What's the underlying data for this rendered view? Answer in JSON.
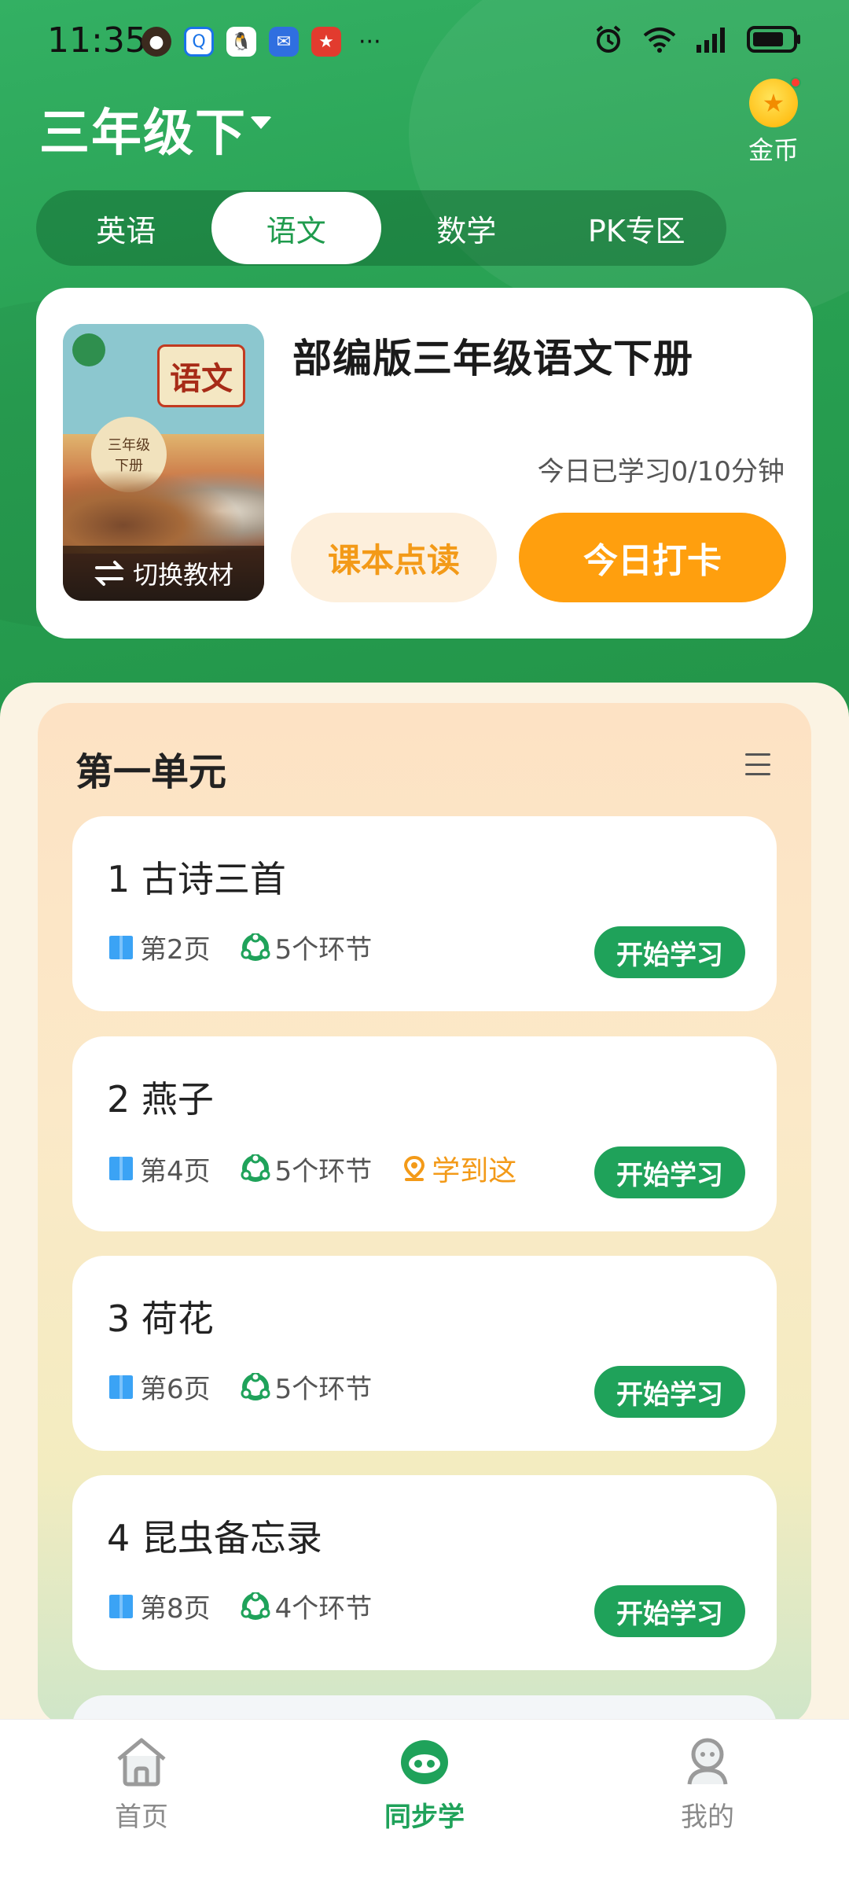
{
  "status_bar": {
    "time": "11:35",
    "more": "···"
  },
  "header": {
    "grade": "三年级下",
    "coins_label": "金币"
  },
  "tabs": [
    {
      "label": "英语",
      "active": false
    },
    {
      "label": "语文",
      "active": true
    },
    {
      "label": "数学",
      "active": false
    },
    {
      "label": "PK专区",
      "active": false
    }
  ],
  "book": {
    "title": "部编版三年级语文下册",
    "cover_subject": "语文",
    "cover_grade": "三年级",
    "cover_volume": "下册",
    "switch_label": "切换教材",
    "study_time": "今日已学习0/10分钟",
    "read_button": "课本点读",
    "checkin_button": "今日打卡"
  },
  "unit": {
    "title": "第一单元",
    "lessons": [
      {
        "title": "1 古诗三首",
        "page": "第2页",
        "steps": "5个环节",
        "marker": "",
        "button": "开始学习"
      },
      {
        "title": "2 燕子",
        "page": "第4页",
        "steps": "5个环节",
        "marker": "学到这",
        "button": "开始学习"
      },
      {
        "title": "3 荷花",
        "page": "第6页",
        "steps": "5个环节",
        "marker": "",
        "button": "开始学习"
      },
      {
        "title": "4 昆虫备忘录",
        "page": "第8页",
        "steps": "4个环节",
        "marker": "",
        "button": "开始学习"
      }
    ]
  },
  "bottom_nav": [
    {
      "label": "首页",
      "icon": "home-icon",
      "active": false
    },
    {
      "label": "同步学",
      "icon": "sync-learn-icon",
      "active": true
    },
    {
      "label": "我的",
      "icon": "profile-icon",
      "active": false
    }
  ],
  "colors": {
    "brand_green": "#1fa25a",
    "orange": "#ff9f0e",
    "orange_light": "#fdefdc"
  }
}
